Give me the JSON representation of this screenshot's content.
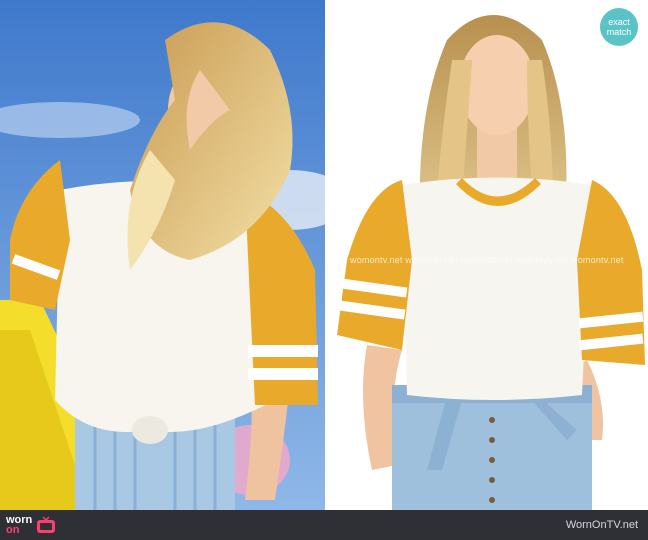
{
  "badge": {
    "line1": "exact",
    "line2": "match",
    "color": "#5bc2c6"
  },
  "watermark": {
    "text": "womontv.net womontv.net womontv.net womontv.net womontv.net"
  },
  "footer": {
    "logo_top": "worn",
    "logo_bottom": "on",
    "logo_icon": "tv-icon",
    "site": "WornOnTV.net",
    "bg_color": "#2f2f36",
    "accent_color": "#ff3e70"
  },
  "photos": [
    {
      "role": "episode-still",
      "subject": "woman in white raglan tee with mustard sleeves"
    },
    {
      "role": "product-photo",
      "subject": "model in white and mustard raglan tee"
    }
  ],
  "colors": {
    "mustard": "#e9aa2c",
    "sky": "#4d8ad6",
    "denim": "#9fc0dc"
  }
}
